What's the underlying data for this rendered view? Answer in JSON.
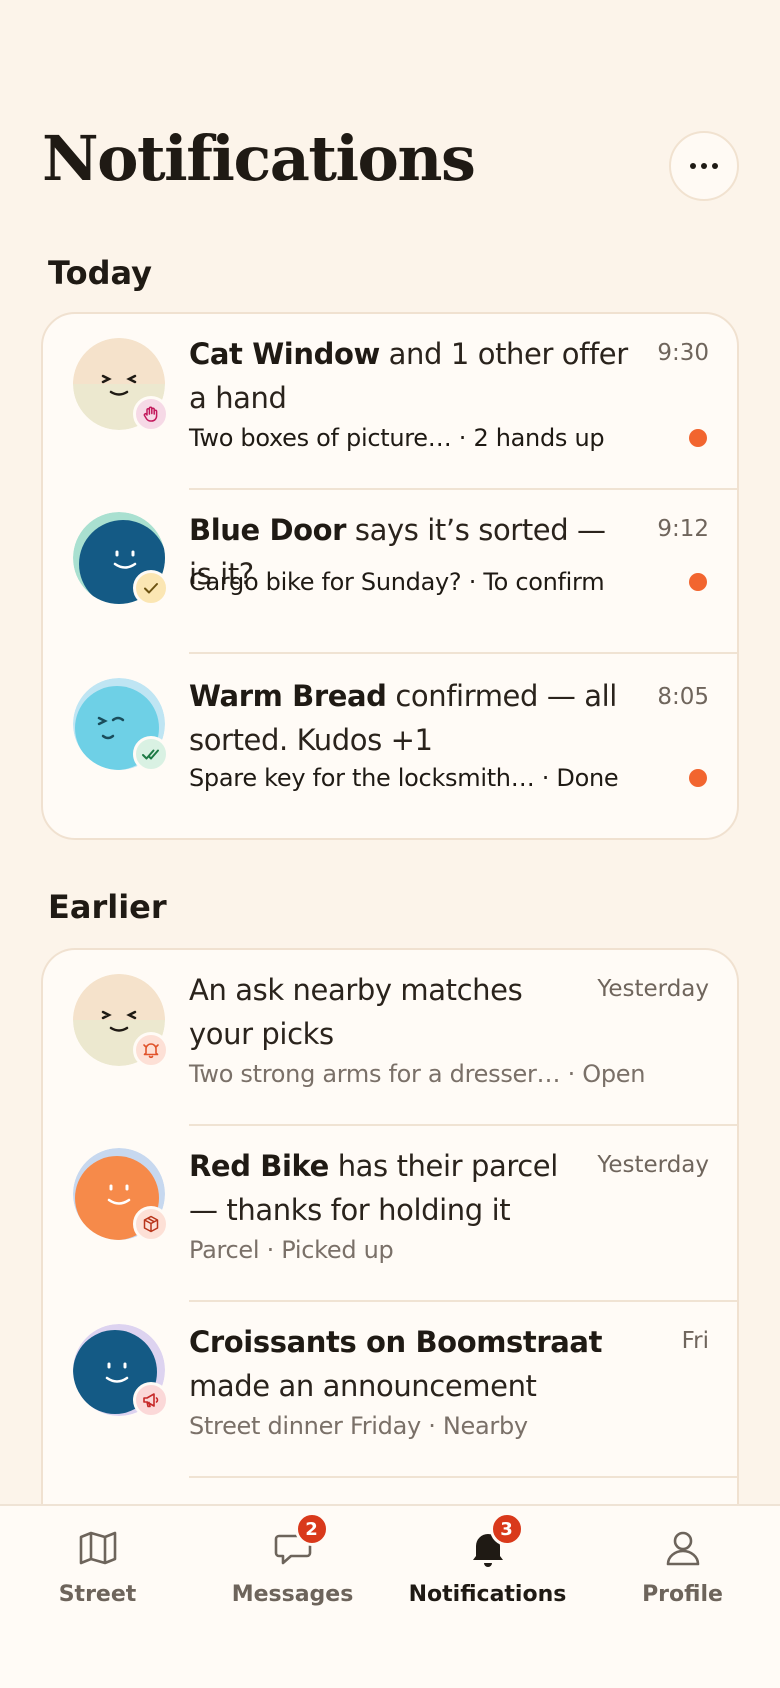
{
  "page": {
    "title": "Notifications",
    "more_label": "More options"
  },
  "sections": {
    "today": "Today",
    "earlier": "Earlier"
  },
  "today": [
    {
      "name": "Cat Window",
      "text": " and 1 other offer a hand",
      "time": "9:30",
      "sub": "Two boxes of picture… · 2 hands up",
      "unread": true,
      "badge_icon": "hand-icon",
      "badge_color": "#f6d9e6"
    },
    {
      "name": "Blue Door",
      "text": " says it’s sorted — is it?",
      "time": "9:12",
      "sub": "Cargo bike for Sunday? · To confirm",
      "unread": true,
      "badge_icon": "check-icon",
      "badge_color": "#fbe6b3"
    },
    {
      "name": "Warm Bread",
      "text": " confirmed — all sorted. Kudos +1",
      "time": "8:05",
      "sub": "Spare key for the locksmith… · Done",
      "unread": true,
      "badge_icon": "double-check-icon",
      "badge_color": "#d9f1e3"
    }
  ],
  "earlier": [
    {
      "name": "",
      "text": "An ask nearby matches your picks",
      "time": "Yesterday",
      "sub": "Two strong arms for a dresser… · Open",
      "unread": false,
      "badge_icon": "bell-icon",
      "badge_color": "#fde0d6"
    },
    {
      "name": "Red Bike",
      "text": " has their parcel — thanks for holding it",
      "time": "Yesterday",
      "sub": "Parcel · Picked up",
      "unread": false,
      "badge_icon": "package-icon",
      "badge_color": "#fde0d6"
    },
    {
      "name": "Croissants on Boomstraat",
      "text": " made an announcement",
      "time": "Fri",
      "sub": "Street dinner Friday · Nearby",
      "unread": false,
      "badge_icon": "megaphone-icon",
      "badge_color": "#fbd8d8"
    }
  ],
  "tabs": {
    "street": "Street",
    "messages": "Messages",
    "messages_count": "2",
    "notifications": "Notifications",
    "notifications_count": "3",
    "profile": "Profile"
  },
  "colors": {
    "background": "#fcf4ea",
    "accent_dot": "#f2652f",
    "badge_red": "#d9391b"
  }
}
